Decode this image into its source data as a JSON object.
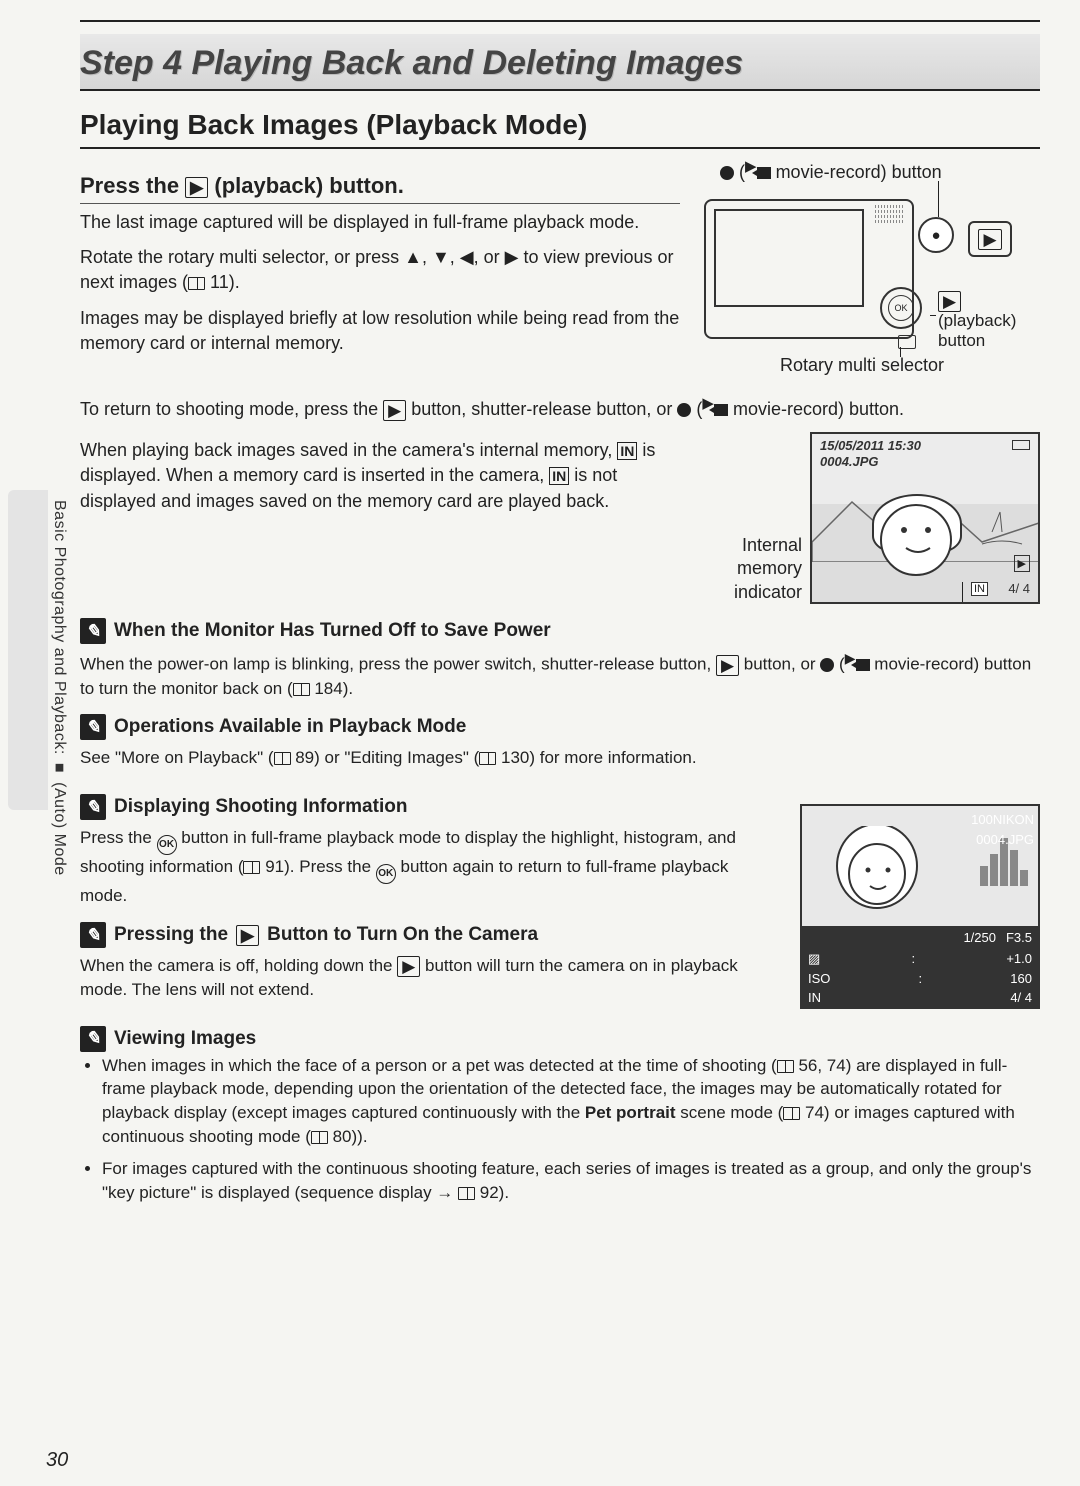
{
  "side_label": "Basic Photography and Playback: ■ (Auto) Mode",
  "banner": "Step 4 Playing Back and Deleting Images",
  "section_title": "Playing Back Images (Playback Mode)",
  "sub1_pre": "Press the ",
  "sub1_post": " (playback) button.",
  "movie_rec_label_pre": "(",
  "movie_rec_label_post": " movie-record) button",
  "p1": "The last image captured will be displayed in full-frame playback mode.",
  "p2a": "Rotate the rotary multi selector, or press ▲, ▼, ◀, or ▶ to view previous or next images (",
  "p2b": " 11).",
  "p3": "Images may be displayed briefly at low resolution while being read from the memory card or internal memory.",
  "playback_btn_label": "(playback) button",
  "rotary_label": "Rotary multi selector",
  "p4a": "To return to shooting mode, press the ",
  "p4b": " button, shutter-release button, or ",
  "p4c": " movie-record) button.",
  "p5a": "When playing back images saved in the camera's internal memory, ",
  "p5b": " is displayed. When a memory card is inserted in the camera, ",
  "p5c": " is not displayed and images saved on the memory card are played back.",
  "internal_mem_caption": "Internal memory indicator",
  "playback_ts": "15/05/2011 15:30",
  "playback_fn": "0004.JPG",
  "playback_counter": "4/    4",
  "note1": {
    "title": "When the Monitor Has Turned Off to Save Power",
    "body_a": "When the power-on lamp is blinking, press the power switch, shutter-release button, ",
    "body_b": " button, or ",
    "body_c": " movie-record) button to turn the monitor back on (",
    "body_d": " 184)."
  },
  "note2": {
    "title": "Operations Available in Playback Mode",
    "body_a": "See \"More on Playback\" (",
    "body_b": " 89) or \"Editing Images\" (",
    "body_c": " 130) for more information."
  },
  "note3": {
    "title": "Displaying Shooting Information",
    "body_a": "Press the ",
    "body_b": " button in full-frame playback mode to display the highlight, histogram, and shooting information (",
    "body_c": " 91). Press the ",
    "body_d": " button again to return to full-frame playback mode."
  },
  "note4": {
    "title_a": "Pressing the ",
    "title_b": " Button to Turn On the Camera",
    "body_a": "When the camera is off, holding down the ",
    "body_b": " button will turn the camera on in playback mode. The lens will not extend."
  },
  "note5": {
    "title": "Viewing Images",
    "li1a": "When images in which the face of a person or a pet was detected at the time of shooting (",
    "li1b": " 56, 74) are displayed in full-frame playback mode, depending upon the orientation of the detected face, the images may be automatically rotated for playback display (except images captured continuously with the ",
    "li1c": "Pet portrait",
    "li1d": " scene mode (",
    "li1e": " 74) or images captured with continuous shooting mode (",
    "li1f": " 80)).",
    "li2a": "For images captured with the continuous shooting feature, each series of images is treated as a group, and only the group's \"key picture\" is displayed (sequence display → ",
    "li2b": " 92)."
  },
  "info_screen": {
    "folder": "100NIKON",
    "file": "0004.JPG",
    "shutter": "1/250",
    "fstop": "F3.5",
    "ev": "+1.0",
    "iso_lbl": "ISO",
    "iso": "160",
    "in": "IN",
    "counter": "4/    4"
  },
  "page_num": "30"
}
